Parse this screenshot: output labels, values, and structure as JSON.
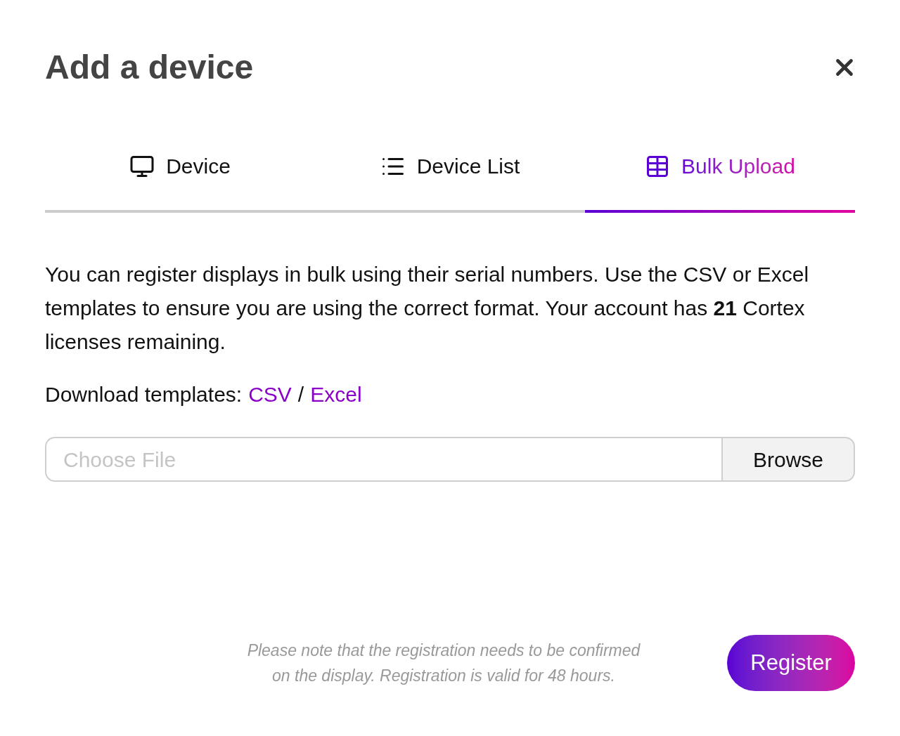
{
  "dialog": {
    "title": "Add a device"
  },
  "tabs": [
    {
      "label": "Device",
      "kind": "monitor",
      "selected": false
    },
    {
      "label": "Device List",
      "kind": "list",
      "selected": false
    },
    {
      "label": "Bulk Upload",
      "kind": "table",
      "selected": true
    }
  ],
  "description": "You can register displays in bulk using their serial numbers. Use the CSV or Excel templates to ensure you are using the correct format. Your account has **21** Cortex licenses remaining.",
  "templates": {
    "label": "Download templates:",
    "links": [
      "CSV",
      "Excel"
    ],
    "separator": "/"
  },
  "file_field": {
    "placeholder": "Choose File",
    "button": "Browse"
  },
  "note": "Please note that the registration needs to be confirmed on the display. Registration is valid for 48 hours.",
  "submit": "Register"
}
